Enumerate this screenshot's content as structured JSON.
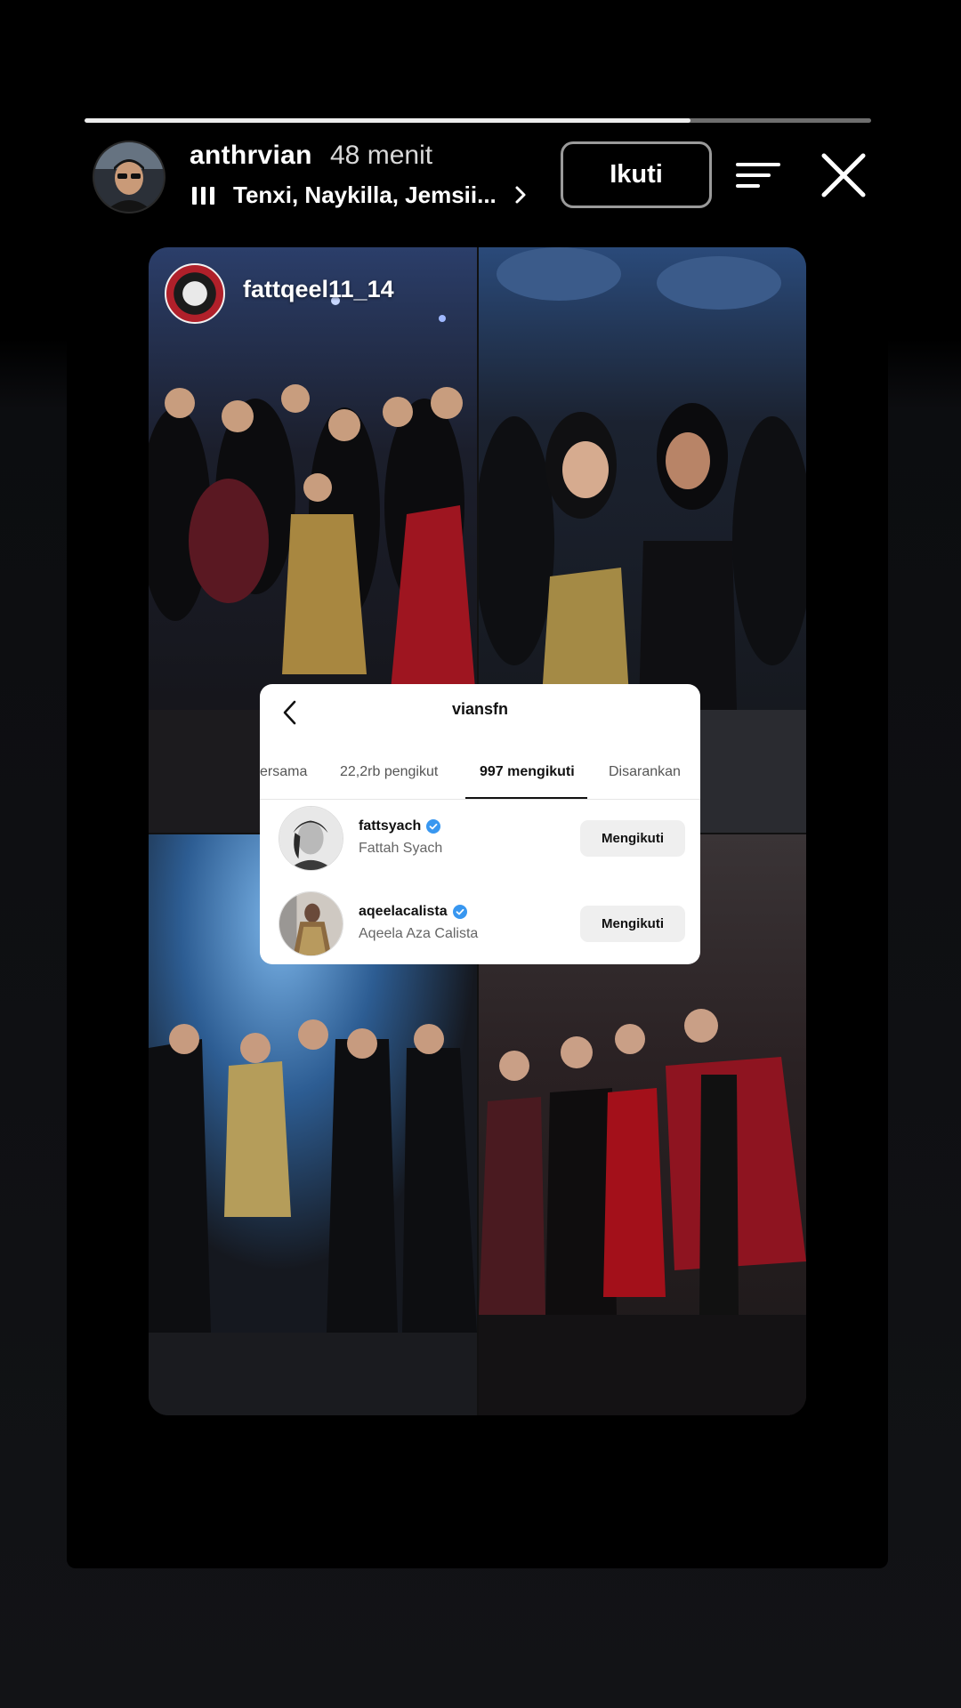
{
  "story": {
    "progress": 0.77,
    "author": {
      "username": "anthrvian",
      "time_ago": "48 menit"
    },
    "music": {
      "text": "Tenxi, Naykilla, Jemsii..."
    },
    "follow_label": "Ikuti",
    "icons": {
      "music": "music-bars-icon",
      "chevron": "chevron-right-icon",
      "menu": "menu-lines-icon",
      "close": "close-icon"
    }
  },
  "reposted_post": {
    "username": "fattqeel11_14"
  },
  "follow_card": {
    "title": "viansfn",
    "tabs": [
      {
        "label": "ersama",
        "active": false
      },
      {
        "label": "22,2rb pengikut",
        "active": false
      },
      {
        "label": "997 mengikuti",
        "active": true
      },
      {
        "label": "Disarankan",
        "active": false
      }
    ],
    "accounts": [
      {
        "username": "fattsyach",
        "full_name": "Fattah Syach",
        "verified": true,
        "button": "Mengikuti"
      },
      {
        "username": "aqeelacalista",
        "full_name": "Aqeela Aza Calista",
        "verified": true,
        "button": "Mengikuti"
      }
    ]
  },
  "colors": {
    "verified_badge": "#3897f0",
    "progress_track": "#6e6e6e",
    "progress_fill": "#ececec"
  }
}
